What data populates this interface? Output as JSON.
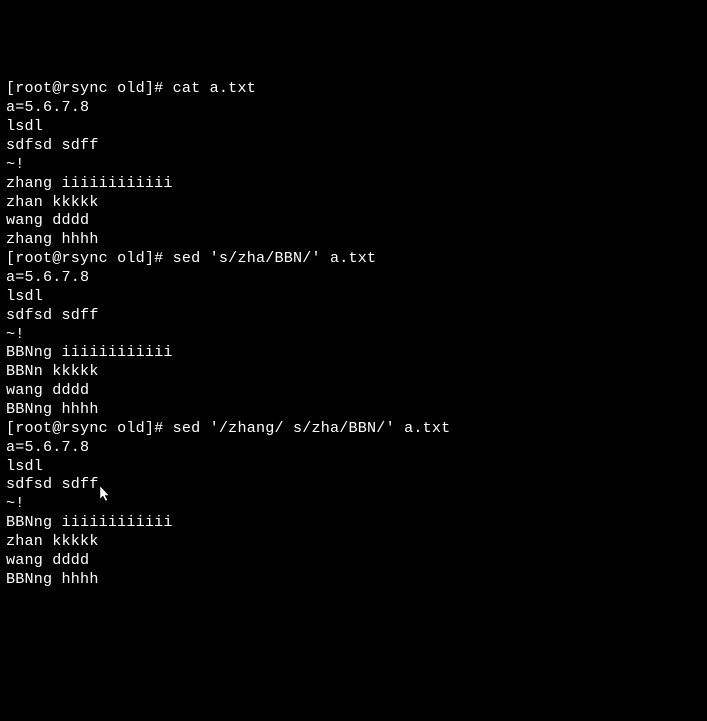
{
  "terminal": {
    "lines": [
      "[root@rsync old]# cat a.txt",
      "a=5.6.7.8",
      "lsdl",
      "sdfsd sdff",
      "~!",
      "zhang iiiiiiiiiiii",
      "zhan kkkkk",
      "wang dddd",
      "zhang hhhh",
      "[root@rsync old]# sed 's/zha/BBN/' a.txt",
      "a=5.6.7.8",
      "lsdl",
      "sdfsd sdff",
      "~!",
      "BBNng iiiiiiiiiiii",
      "BBNn kkkkk",
      "wang dddd",
      "BBNng hhhh",
      "[root@rsync old]# sed '/zhang/ s/zha/BBN/' a.txt",
      "a=5.6.7.8",
      "lsdl",
      "sdfsd sdff",
      "~!",
      "BBNng iiiiiiiiiiii",
      "zhan kkkkk",
      "wang dddd",
      "BBNng hhhh"
    ]
  }
}
